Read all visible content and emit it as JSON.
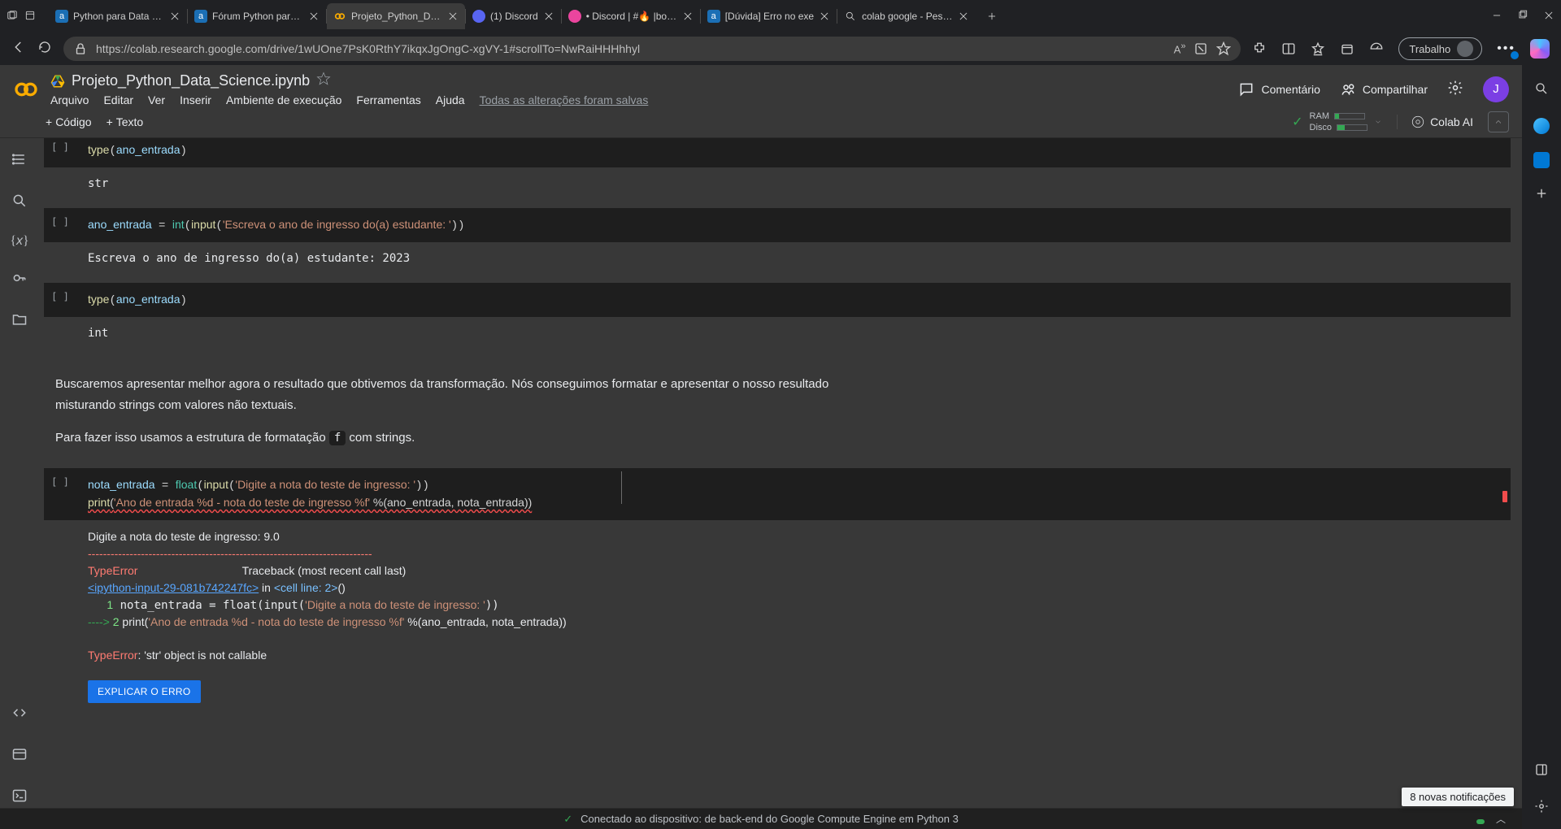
{
  "browser": {
    "tabs": [
      {
        "title": "Python para Data Sci",
        "favicon_bg": "#1b6fb5",
        "favicon_text": "a"
      },
      {
        "title": "Fórum Python para D",
        "favicon_bg": "#1b6fb5",
        "favicon_text": "a"
      },
      {
        "title": "Projeto_Python_Data",
        "favicon_bg": "#f9ab00",
        "favicon_text": "",
        "active": true
      },
      {
        "title": "(1) Discord",
        "favicon_bg": "#5865f2",
        "favicon_text": ""
      },
      {
        "title": "• Discord | #🔥 |boas",
        "favicon_bg": "#eb459e",
        "favicon_text": ""
      },
      {
        "title": "[Dúvida] Erro no exe",
        "favicon_bg": "#1b6fb5",
        "favicon_text": "a"
      },
      {
        "title": "colab google - Pesqu",
        "favicon_bg": "transparent",
        "favicon_text": "🔍"
      }
    ],
    "url": "https://colab.research.google.com/drive/1wUOne7PsK0RthY7ikqxJgOngC-xgVY-1#scrollTo=NwRaiHHHhhyl",
    "work_label": "Trabalho"
  },
  "colab": {
    "doc_title": "Projeto_Python_Data_Science.ipynb",
    "menus": {
      "file": "Arquivo",
      "edit": "Editar",
      "view": "Ver",
      "insert": "Inserir",
      "runtime": "Ambiente de execução",
      "tools": "Ferramentas",
      "help": "Ajuda",
      "save_status": "Todas as alterações foram salvas"
    },
    "header": {
      "comment": "Comentário",
      "share": "Compartilhar",
      "avatar_initial": "J"
    },
    "toolbar": {
      "code": "Código",
      "text": "Texto",
      "ram_label": "RAM",
      "disk_label": "Disco",
      "ram_pct": 15,
      "disk_pct": 25,
      "colab_ai": "Colab AI"
    },
    "cells": {
      "c0_code": "type(ano_entrada)",
      "c0_out": "str",
      "c1_code_pre": "ano_entrada = ",
      "c1_fn": "int",
      "c1_input": "input",
      "c1_str": "'Escreva o ano de ingresso do(a) estudante: '",
      "c1_out": "Escreva o ano de ingresso do(a) estudante: 2023",
      "c2_code": "type(ano_entrada)",
      "c2_out": "int",
      "md_p1": "Buscaremos apresentar melhor agora o resultado que obtivemos da transformação. Nós conseguimos formatar e apresentar o nosso resultado misturando strings com valores não textuais.",
      "md_p2a": "Para fazer isso usamos a estrutura de formatação ",
      "md_code": "f",
      "md_p2b": " com strings.",
      "c3_l1_pre": "nota_entrada = ",
      "c3_l1_fn": "float",
      "c3_l1_input": "input",
      "c3_l1_str": "'Digite a nota do teste de ingresso: '",
      "c3_l2_fn": "print",
      "c3_l2_str": "'Ano de entrada %d - nota do teste de ingresso %f'",
      "c3_l2_args": " %(ano_entrada, nota_entrada))",
      "c3_out_prompt": "Digite a nota do teste de ingresso: 9.0",
      "c3_out_dash": "---------------------------------------------------------------------------",
      "c3_out_err1": "TypeError",
      "c3_out_tb": "                                 Traceback (most recent call last)",
      "c3_out_link": "<ipython-input-29-081b742247fc>",
      "c3_out_in": " in ",
      "c3_out_cell": "<cell line: 2>",
      "c3_out_paren": "()",
      "c3_out_l1": "      1 nota_entrada = float(input('Digite a nota do teste de ingresso: '))",
      "c3_out_arrow": "----> ",
      "c3_out_l2num": "2 ",
      "c3_out_l2a": "print(",
      "c3_out_l2str": "'Ano de entrada %d - nota do teste de ingresso %f'",
      "c3_out_l2b": " %(ano_entrada, nota_entrada))",
      "c3_out_err2": "TypeError",
      "c3_out_msg": ": 'str' object is not callable",
      "explain": "EXPLICAR O ERRO"
    },
    "status": "Conectado ao dispositivo: de back-end do Google Compute Engine em Python 3",
    "notif": "8 novas notificações"
  }
}
